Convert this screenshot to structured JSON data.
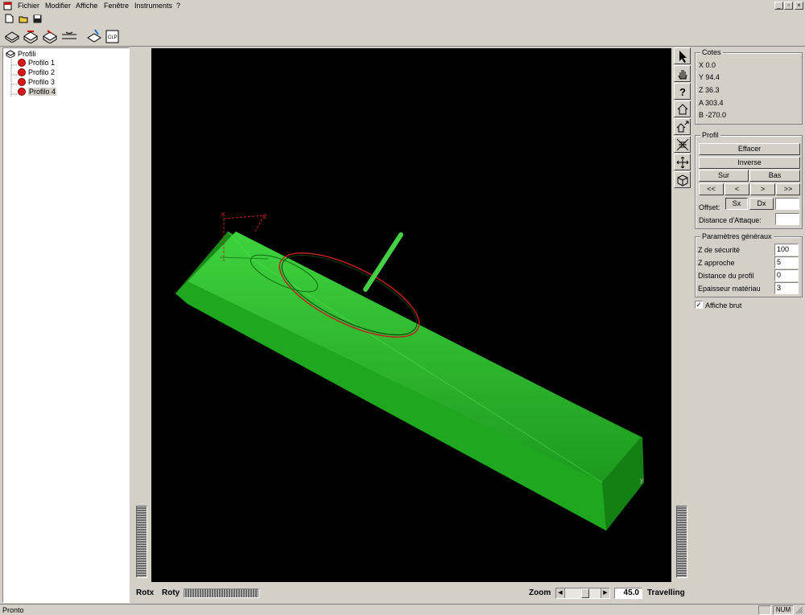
{
  "menu": {
    "items": [
      "Fichier",
      "Modifier",
      "Affiche",
      "Fenêtre",
      "Instruments",
      "?"
    ]
  },
  "tree": {
    "root": "Profili",
    "items": [
      "Profilo 1",
      "Profilo 2",
      "Profilo 3",
      "Profilo 4"
    ],
    "selected_index": 3
  },
  "cotes": {
    "title": "Cotes",
    "x": "X 0.0",
    "y": "Y 94.4",
    "z": "Z 36.3",
    "a": "A 303.4",
    "b": "B -270.0"
  },
  "profil": {
    "title": "Profil",
    "effacer": "Effacer",
    "inverse": "Inverse",
    "sur": "Sur",
    "bas": "Bas",
    "nav_first": "<<",
    "nav_prev": "<",
    "nav_next": ">",
    "nav_last": ">>",
    "offset_label": "Offset:",
    "sx": "Sx",
    "dx": "Dx",
    "offset_value": "",
    "distance_attaque_label": "Distance d'Attaque:",
    "distance_attaque_value": ""
  },
  "params": {
    "title": "Paramètres généraux",
    "z_securite_label": "Z de sécurité",
    "z_securite": "100",
    "z_approche_label": "Z approche",
    "z_approche": "5",
    "distance_profil_label": "Distance du profil",
    "distance_profil": "0",
    "epaisseur_label": "Epaisseur matériau",
    "epaisseur": "3",
    "affiche_brut_label": "Affiche brut",
    "affiche_brut_checked": true
  },
  "viewport": {
    "axis_x": "x",
    "axis_z": "z",
    "axis_y": "y",
    "solid_color": "#22b422",
    "profile_color": "#c02020"
  },
  "bottom": {
    "rotx": "Rotx",
    "roty": "Roty",
    "zoom_label": "Zoom",
    "zoom_value": "45.0",
    "travelling": "Travelling"
  },
  "status": {
    "text": "Pronto",
    "num": "NUM"
  }
}
